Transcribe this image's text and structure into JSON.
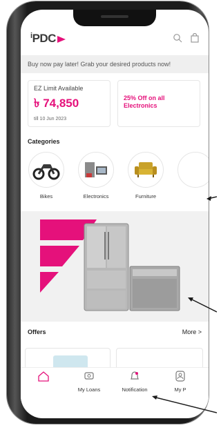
{
  "app": {
    "logo_text": "PDC"
  },
  "header": {
    "search_icon": "search-icon",
    "bag_icon": "bag-icon"
  },
  "promo_banner": {
    "text": "Buy now pay later! Grab your desired products now!"
  },
  "ez_card": {
    "title": "EZ Limit Available",
    "amount": "৳ 74,850",
    "date": "till 10 Jun 2023"
  },
  "offer_card": {
    "text": "25% Off on all Electronics"
  },
  "categories": {
    "title": "Categories",
    "items": [
      {
        "label": "Bikes",
        "icon": "motorbike-icon"
      },
      {
        "label": "Electronics",
        "icon": "electronics-icon"
      },
      {
        "label": "Furniture",
        "icon": "sofa-icon"
      }
    ]
  },
  "offers": {
    "title": "Offers",
    "more_label": "More >"
  },
  "tabbar": {
    "items": [
      {
        "label": "",
        "icon": "home-icon"
      },
      {
        "label": "My Loans",
        "icon": "loan-icon"
      },
      {
        "label": "Notification",
        "icon": "bell-icon"
      },
      {
        "label": "My P",
        "icon": "profile-icon"
      }
    ]
  },
  "colors": {
    "accent": "#e5117b",
    "promo_bg": "#efefef",
    "frame": "#1b1b1b"
  }
}
